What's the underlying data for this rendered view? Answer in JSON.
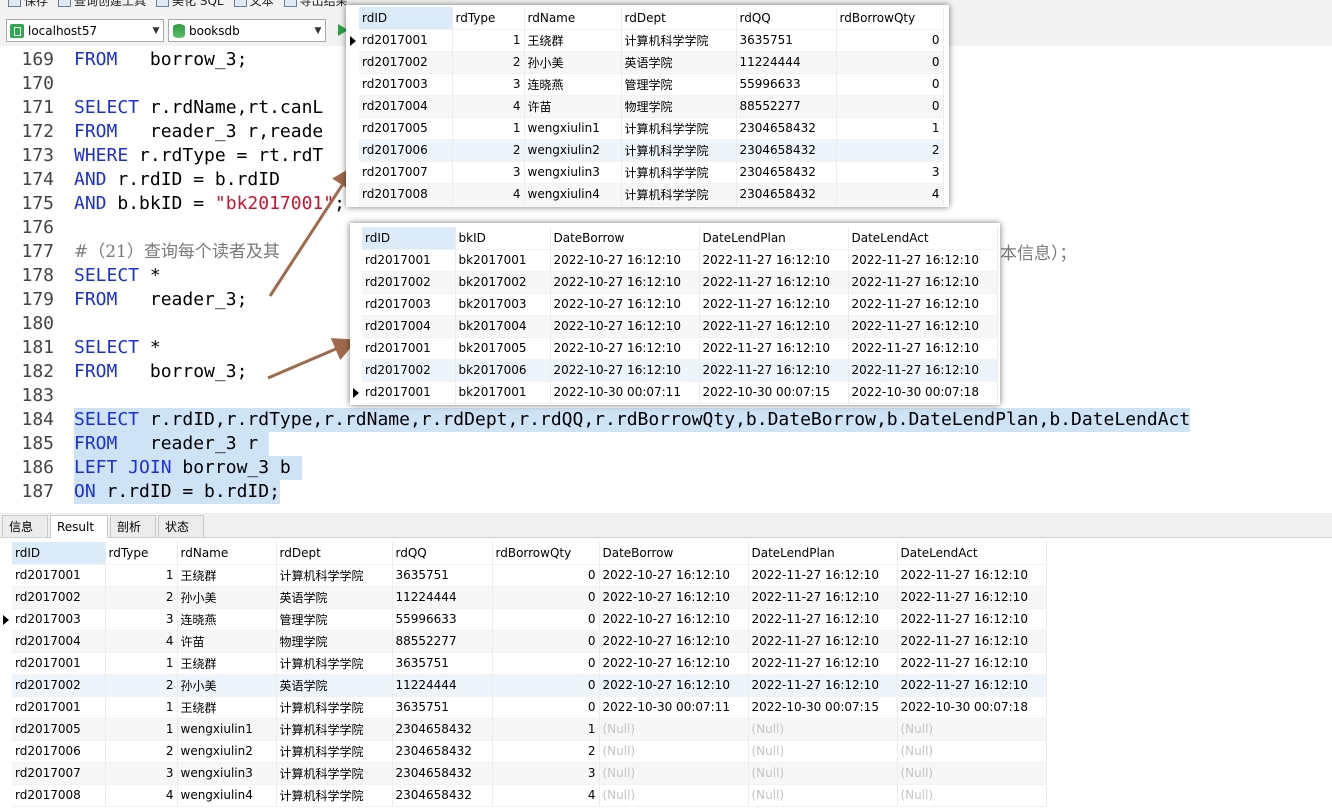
{
  "toolbar": {
    "items": [
      "保存",
      "查询创建工具",
      "美化 SQL",
      "文本",
      "导出结果"
    ],
    "connection": "localhost57",
    "database": "booksdb"
  },
  "editor": {
    "lines": [
      {
        "n": "169",
        "html": "<span class=\"kw\">FROM</span>   borrow_3;"
      },
      {
        "n": "170",
        "html": ""
      },
      {
        "n": "171",
        "html": "<span class=\"kw\">SELECT</span> r.rdName,rt.canL"
      },
      {
        "n": "172",
        "html": "<span class=\"kw\">FROM</span>   reader_3 r,reade"
      },
      {
        "n": "173",
        "html": "<span class=\"kw\">WHERE</span> r.rdType = rt.rdT"
      },
      {
        "n": "174",
        "html": "<span class=\"kw\">AND</span> r.rdID = b.rdID"
      },
      {
        "n": "175",
        "html": "<span class=\"kw\">AND</span> b.bkID = <span class=\"str\">\"bk2017001\"</span>;"
      },
      {
        "n": "176",
        "html": ""
      },
      {
        "n": "177",
        "html": "<span class=\"cm\">#（21）查询每个读者及其</span>"
      },
      {
        "n": "178",
        "html": "<span class=\"kw\">SELECT</span> *"
      },
      {
        "n": "179",
        "html": "<span class=\"kw\">FROM</span>   reader_3;"
      },
      {
        "n": "180",
        "html": ""
      },
      {
        "n": "181",
        "html": "<span class=\"kw\">SELECT</span> *"
      },
      {
        "n": "182",
        "html": "<span class=\"kw\">FROM</span>   borrow_3;"
      },
      {
        "n": "183",
        "html": ""
      },
      {
        "n": "184",
        "html": "<span class=\"kw\">SELECT</span> r.rdID,r.rdType,r.rdName,r.rdDept,r.rdQQ,r.rdBorrowQty,b.DateBorrow,b.DateLendPlan,b.DateLendAct",
        "sel": true
      },
      {
        "n": "185",
        "html": "<span class=\"kw\">FROM</span>   reader_3 r ",
        "sel": true
      },
      {
        "n": "186",
        "html": "<span class=\"kw\">LEFT JOIN</span> borrow_3 b ",
        "sel": true
      },
      {
        "n": "187",
        "html": "<span class=\"kw\">ON</span> r.rdID = b.rdID;",
        "sel": true
      }
    ],
    "comment_tail": "本信息）；"
  },
  "reader_popup": {
    "columns": [
      "rdID",
      "rdType",
      "rdName",
      "rdDept",
      "rdQQ",
      "rdBorrowQty"
    ],
    "rows": [
      [
        "rd2017001",
        "1",
        "王绕群",
        "计算机科学学院",
        "3635751",
        "0"
      ],
      [
        "rd2017002",
        "2",
        "孙小美",
        "英语学院",
        "11224444",
        "0"
      ],
      [
        "rd2017003",
        "3",
        "连晓燕",
        "管理学院",
        "55996633",
        "0"
      ],
      [
        "rd2017004",
        "4",
        "许苗",
        "物理学院",
        "88552277",
        "0"
      ],
      [
        "rd2017005",
        "1",
        "wengxiulin1",
        "计算机科学学院",
        "2304658432",
        "1"
      ],
      [
        "rd2017006",
        "2",
        "wengxiulin2",
        "计算机科学学院",
        "2304658432",
        "2"
      ],
      [
        "rd2017007",
        "3",
        "wengxiulin3",
        "计算机科学学院",
        "2304658432",
        "3"
      ],
      [
        "rd2017008",
        "4",
        "wengxiulin4",
        "计算机科学学院",
        "2304658432",
        "4"
      ]
    ]
  },
  "borrow_popup": {
    "columns": [
      "rdID",
      "bkID",
      "DateBorrow",
      "DateLendPlan",
      "DateLendAct"
    ],
    "rows": [
      [
        "rd2017001",
        "bk2017001",
        "2022-10-27 16:12:10",
        "2022-11-27 16:12:10",
        "2022-11-27 16:12:10"
      ],
      [
        "rd2017002",
        "bk2017002",
        "2022-10-27 16:12:10",
        "2022-11-27 16:12:10",
        "2022-11-27 16:12:10"
      ],
      [
        "rd2017003",
        "bk2017003",
        "2022-10-27 16:12:10",
        "2022-11-27 16:12:10",
        "2022-11-27 16:12:10"
      ],
      [
        "rd2017004",
        "bk2017004",
        "2022-10-27 16:12:10",
        "2022-11-27 16:12:10",
        "2022-11-27 16:12:10"
      ],
      [
        "rd2017001",
        "bk2017005",
        "2022-10-27 16:12:10",
        "2022-11-27 16:12:10",
        "2022-11-27 16:12:10"
      ],
      [
        "rd2017002",
        "bk2017006",
        "2022-10-27 16:12:10",
        "2022-11-27 16:12:10",
        "2022-11-27 16:12:10"
      ],
      [
        "rd2017001",
        "bk2017001",
        "2022-10-30 00:07:11",
        "2022-10-30 00:07:15",
        "2022-10-30 00:07:18"
      ]
    ]
  },
  "tabs": [
    "信息",
    "Result 1",
    "剖析",
    "状态"
  ],
  "result": {
    "columns": [
      "rdID",
      "rdType",
      "rdName",
      "rdDept",
      "rdQQ",
      "rdBorrowQty",
      "DateBorrow",
      "DateLendPlan",
      "DateLendAct"
    ],
    "rows": [
      [
        "rd2017001",
        "1",
        "王绕群",
        "计算机科学学院",
        "3635751",
        "0",
        "2022-10-27 16:12:10",
        "2022-11-27 16:12:10",
        "2022-11-27 16:12:10"
      ],
      [
        "rd2017002",
        "2",
        "孙小美",
        "英语学院",
        "11224444",
        "0",
        "2022-10-27 16:12:10",
        "2022-11-27 16:12:10",
        "2022-11-27 16:12:10"
      ],
      [
        "rd2017003",
        "3",
        "连晓燕",
        "管理学院",
        "55996633",
        "0",
        "2022-10-27 16:12:10",
        "2022-11-27 16:12:10",
        "2022-11-27 16:12:10"
      ],
      [
        "rd2017004",
        "4",
        "许苗",
        "物理学院",
        "88552277",
        "0",
        "2022-10-27 16:12:10",
        "2022-11-27 16:12:10",
        "2022-11-27 16:12:10"
      ],
      [
        "rd2017001",
        "1",
        "王绕群",
        "计算机科学学院",
        "3635751",
        "0",
        "2022-10-27 16:12:10",
        "2022-11-27 16:12:10",
        "2022-11-27 16:12:10"
      ],
      [
        "rd2017002",
        "2",
        "孙小美",
        "英语学院",
        "11224444",
        "0",
        "2022-10-27 16:12:10",
        "2022-11-27 16:12:10",
        "2022-11-27 16:12:10"
      ],
      [
        "rd2017001",
        "1",
        "王绕群",
        "计算机科学学院",
        "3635751",
        "0",
        "2022-10-30 00:07:11",
        "2022-10-30 00:07:15",
        "2022-10-30 00:07:18"
      ],
      [
        "rd2017005",
        "1",
        "wengxiulin1",
        "计算机科学学院",
        "2304658432",
        "1",
        "(Null)",
        "(Null)",
        "(Null)"
      ],
      [
        "rd2017006",
        "2",
        "wengxiulin2",
        "计算机科学学院",
        "2304658432",
        "2",
        "(Null)",
        "(Null)",
        "(Null)"
      ],
      [
        "rd2017007",
        "3",
        "wengxiulin3",
        "计算机科学学院",
        "2304658432",
        "3",
        "(Null)",
        "(Null)",
        "(Null)"
      ],
      [
        "rd2017008",
        "4",
        "wengxiulin4",
        "计算机科学学院",
        "2304658432",
        "4",
        "(Null)",
        "(Null)",
        "(Null)"
      ]
    ]
  }
}
